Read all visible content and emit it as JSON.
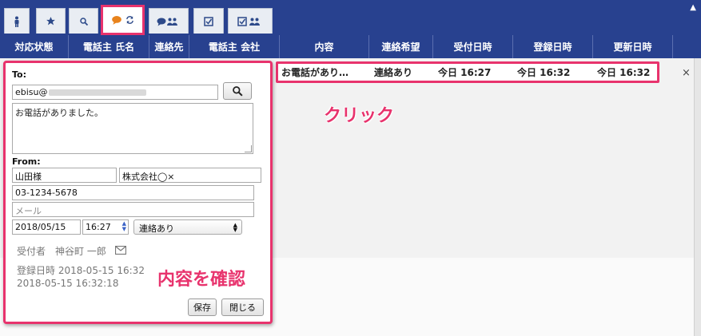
{
  "colors": {
    "nav_bg": "#28418f",
    "highlight": "#e8336d",
    "tab_bg": "#e9edf3"
  },
  "tabs": [
    {
      "icon": "person-icon"
    },
    {
      "icon": "star-icon"
    },
    {
      "icon": "search-icon"
    },
    {
      "icon": "chat-sync-icon",
      "active": true
    },
    {
      "icon": "chat-group-icon"
    },
    {
      "icon": "check-icon"
    },
    {
      "icon": "check-group-icon"
    }
  ],
  "columns": [
    "対応状態",
    "電話主 氏名",
    "連絡先",
    "電話主 会社",
    "内容",
    "連絡希望",
    "受付日時",
    "登録日時",
    "更新日時"
  ],
  "row": {
    "content": "お電話があり…",
    "contact_request": "連絡あり",
    "received": "今日 16:27",
    "registered": "今日 16:32",
    "updated": "今日 16:32",
    "close": "×"
  },
  "annotations": {
    "click": "クリック",
    "confirm": "内容を確認"
  },
  "form": {
    "to_label": "To:",
    "to_value": "ebisu@",
    "message": "お電話がありました。",
    "from_label": "From:",
    "name": "山田様",
    "company": "株式会社◯×",
    "phone": "03-1234-5678",
    "email_placeholder": "メール",
    "date": "2018/05/15",
    "time": "16:27",
    "contact_option": "連絡あり",
    "receiver_label": "受付者",
    "receiver_name": "神谷町 一郎",
    "registered_line": "登録日時 2018-05-15 16:32",
    "updated_line": "2018-05-15 16:32:18",
    "save": "保存",
    "close": "閉じる"
  }
}
